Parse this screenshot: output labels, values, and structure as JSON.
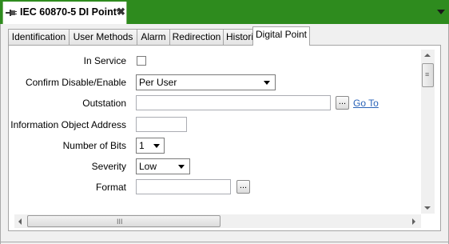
{
  "document": {
    "title": "IEC 60870-5 DI Point*",
    "close_glyph": "✖",
    "icon": "point-plug-icon",
    "accent_color": "#2e8b1e"
  },
  "tabs": [
    {
      "label": "Identification"
    },
    {
      "label": "User Methods"
    },
    {
      "label": "Alarm"
    },
    {
      "label": "Redirection"
    },
    {
      "label": "Historic"
    },
    {
      "label": "Digital Point",
      "active": true
    }
  ],
  "form": {
    "in_service": {
      "label": "In Service",
      "checked": false
    },
    "confirm": {
      "label": "Confirm Disable/Enable",
      "value": "Per User"
    },
    "outstation": {
      "label": "Outstation",
      "value": "",
      "browse": "...",
      "link": "Go To"
    },
    "ioa": {
      "label": "Information Object Address",
      "value": ""
    },
    "bits": {
      "label": "Number of Bits",
      "value": "1"
    },
    "severity": {
      "label": "Severity",
      "value": "Low"
    },
    "format": {
      "label": "Format",
      "value": "",
      "browse": "..."
    }
  },
  "scrollbars": {
    "vertical_grip": "≡",
    "horizontal_grip": "III"
  }
}
